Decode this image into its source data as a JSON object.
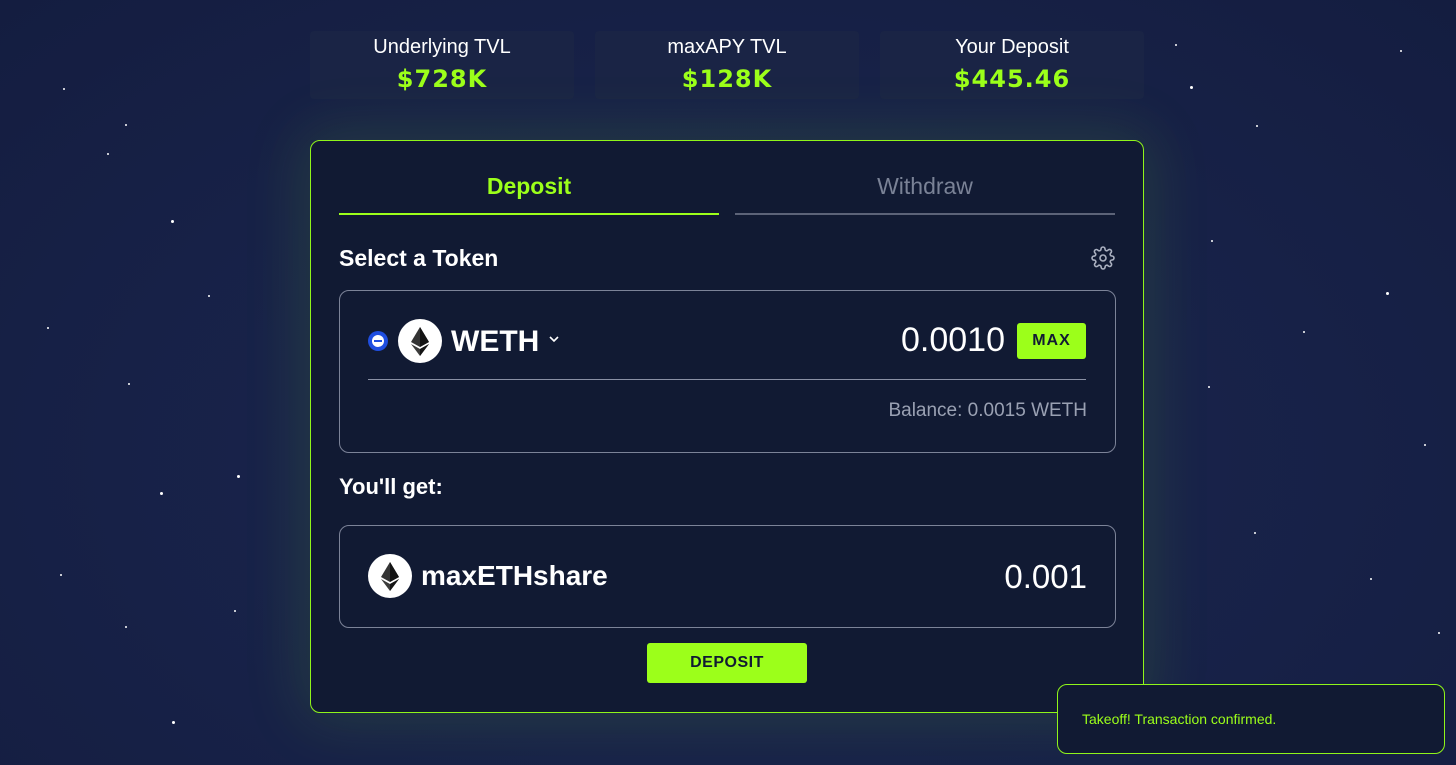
{
  "stats": [
    {
      "label": "Underlying TVL",
      "value": "$728K"
    },
    {
      "label": "maxAPY TVL",
      "value": "$128K"
    },
    {
      "label": "Your Deposit",
      "value": "$445.46"
    }
  ],
  "tabs": {
    "deposit": "Deposit",
    "withdraw": "Withdraw",
    "active": "deposit"
  },
  "select_token": {
    "title": "Select a Token",
    "token": "WETH",
    "token_icon": "ethereum-icon",
    "amount": "0.0010",
    "max_label": "MAX",
    "balance": "Balance: 0.0015 WETH"
  },
  "receive": {
    "title": "You'll get:",
    "token": "maxETHshare",
    "token_icon": "ethereum-icon",
    "amount": "0.001"
  },
  "deposit_button": "DEPOSIT",
  "toast": {
    "message": "Takeoff! Transaction confirmed."
  },
  "colors": {
    "accent": "#9cff1a",
    "background": "#172147",
    "card": "#111a33",
    "muted": "#7a8296",
    "radio": "#1f4ee0"
  }
}
